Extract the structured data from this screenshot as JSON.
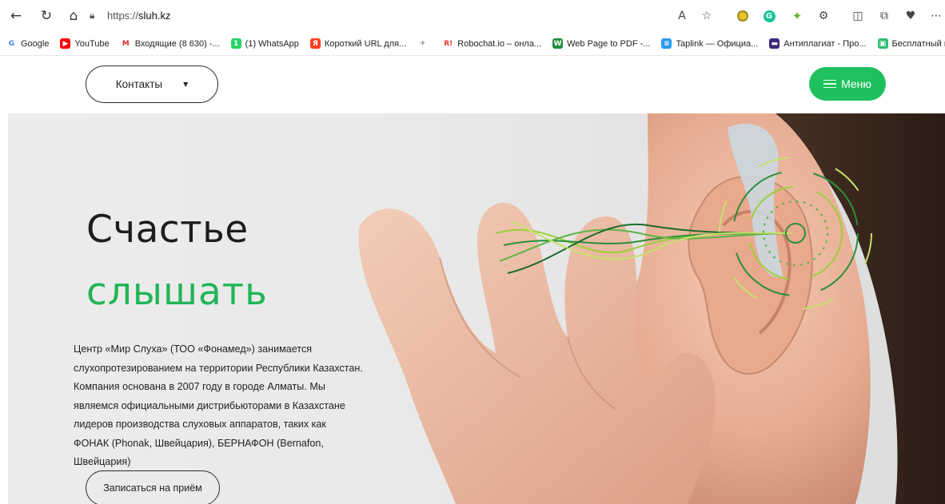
{
  "browser": {
    "url_prefix": "https://",
    "url_host": "sluh.kz",
    "bookmarks": [
      {
        "label": "Google",
        "color": "#ffffff",
        "glyph": "G",
        "glyph_color": "#4285f4"
      },
      {
        "label": "YouTube",
        "color": "#ff0000",
        "glyph": "▶",
        "glyph_color": "#ffffff"
      },
      {
        "label": "Входящие (8 630) -...",
        "color": "#ffffff",
        "glyph": "M",
        "glyph_color": "#d93025"
      },
      {
        "label": "(1) WhatsApp",
        "color": "#25d366",
        "glyph": "1",
        "glyph_color": "#ffffff"
      },
      {
        "label": "Короткий URL для...",
        "color": "#fc3f1d",
        "glyph": "Я",
        "glyph_color": "#ffffff"
      },
      {
        "label": "",
        "color": "#ffffff",
        "glyph": "✈",
        "glyph_color": "#888888"
      },
      {
        "label": "Robochat.io – онла...",
        "color": "#ffffff",
        "glyph": "R!",
        "glyph_color": "#e53935"
      },
      {
        "label": "Web Page to PDF -...",
        "color": "#1e8e3e",
        "glyph": "W",
        "glyph_color": "#ffffff"
      },
      {
        "label": "Taplink — Официа...",
        "color": "#2b9af3",
        "glyph": "≡",
        "glyph_color": "#ffffff"
      },
      {
        "label": "Антиплагиат - Про...",
        "color": "#3b2a7a",
        "glyph": "▬",
        "glyph_color": "#ffffff"
      },
      {
        "label": "Бесплатный конст...",
        "color": "#2fbf71",
        "glyph": "▣",
        "glyph_color": "#ffffff"
      }
    ]
  },
  "header": {
    "contacts_label": "Контакты",
    "menu_label": "Меню"
  },
  "hero": {
    "title_line1": "Счастье",
    "title_line2": "слышать",
    "description_lines": [
      "Центр «Мир Слуха» (ТОО «Фонамед») занимается",
      "слухопротезированием на территории Республики Казахстан.",
      "Компания основана в 2007 году в городе Алматы. Мы",
      "являемся официальными дистрибьюторами в Казахстане",
      "лидеров производства слуховых аппаратов, таких как",
      "ФОНАК (Phonak, Швейцария), БЕРНАФОН (Bernafon,",
      "Швейцария)"
    ],
    "appointment_label": "Записаться на приём"
  },
  "colors": {
    "accent_green": "#1fc15e",
    "title_green": "#21b556"
  }
}
